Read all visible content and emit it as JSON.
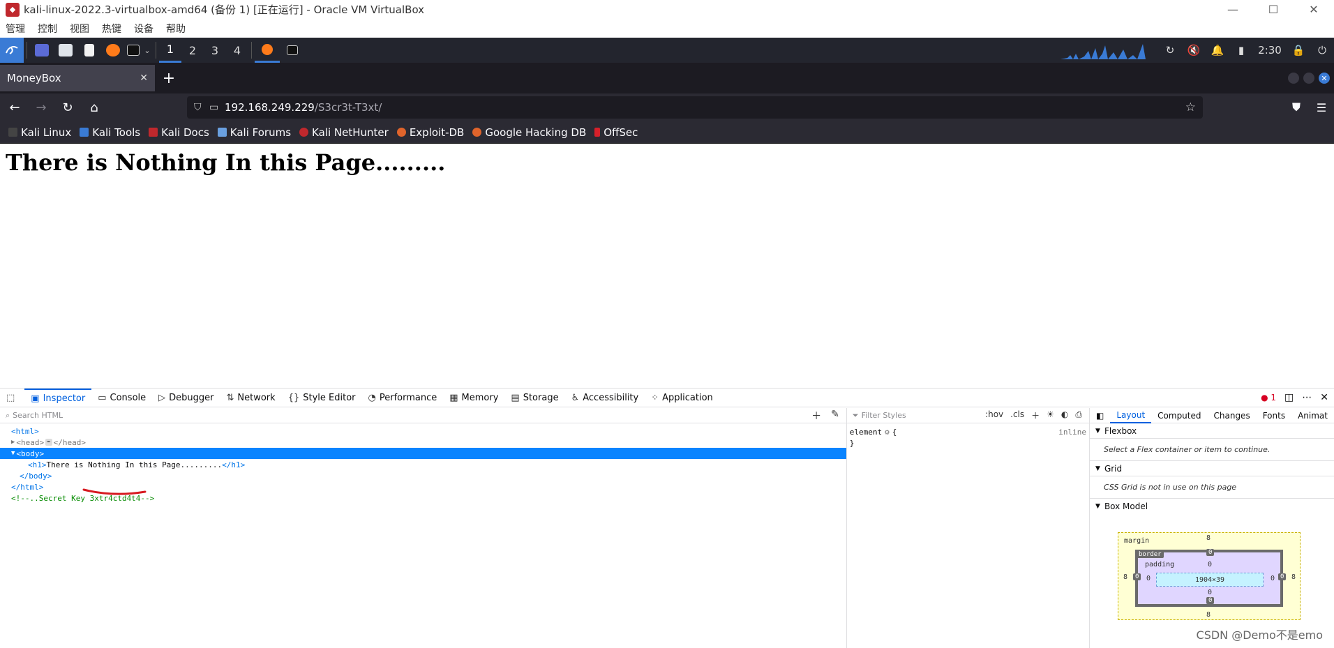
{
  "window": {
    "title": "kali-linux-2022.3-virtualbox-amd64 (备份 1) [正在运行] - Oracle VM VirtualBox",
    "controls": [
      "—",
      "☐",
      "✕"
    ]
  },
  "vbox_menu": [
    "管理",
    "控制",
    "视图",
    "热键",
    "设备",
    "帮助"
  ],
  "kali_panel": {
    "workspaces": [
      "1",
      "2",
      "3",
      "4"
    ],
    "clock": "2:30",
    "colors": {
      "panel": "#23252e",
      "accent": "#3a7bd5"
    }
  },
  "browser": {
    "tab_title": "MoneyBox",
    "new_tab": "+",
    "url_host": "192.168.249.229",
    "url_path": "/S3cr3t-T3xt/",
    "bookmarks": [
      "Kali Linux",
      "Kali Tools",
      "Kali Docs",
      "Kali Forums",
      "Kali NetHunter",
      "Exploit-DB",
      "Google Hacking DB",
      "OffSec"
    ]
  },
  "page": {
    "heading": "There is Nothing In this Page........."
  },
  "devtools": {
    "tabs": [
      "Inspector",
      "Console",
      "Debugger",
      "Network",
      "Style Editor",
      "Performance",
      "Memory",
      "Storage",
      "Accessibility",
      "Application"
    ],
    "error_count": "1",
    "search_placeholder": "Search HTML",
    "tree": {
      "html_open": "<html>",
      "head": "<head>",
      "head_close": "</head>",
      "body_open": "<body>",
      "h1_open": "<h1>",
      "h1_text": "There is Nothing In this Page.........",
      "h1_close": "</h1>",
      "body_close": "</body>",
      "html_close": "</html>",
      "comment": "<!--..Secret Key 3xtr4ctd4t4-->"
    },
    "rules": {
      "filter_placeholder": "Filter Styles",
      "hov": ":hov",
      "cls": ".cls",
      "selector": "element",
      "brace_open": "{",
      "brace_close": "}",
      "inline": "inline"
    },
    "layout_tabs": [
      "Layout",
      "Computed",
      "Changes",
      "Fonts",
      "Animat"
    ],
    "flexbox": {
      "title": "Flexbox",
      "msg": "Select a Flex container or item to continue."
    },
    "grid": {
      "title": "Grid",
      "msg": "CSS Grid is not in use on this page"
    },
    "box_model": {
      "title": "Box Model",
      "margin_label": "margin",
      "border_label": "border",
      "padding_label": "padding",
      "content_size": "1904×39",
      "margin": "8",
      "zero": "0"
    }
  },
  "watermark": "CSDN @Demo不是emo"
}
